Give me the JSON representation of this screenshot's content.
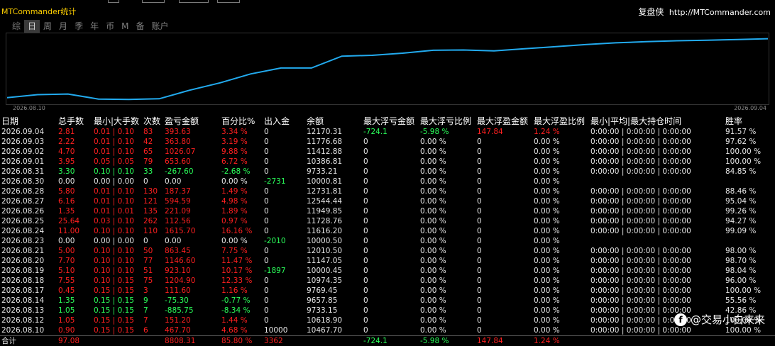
{
  "header": {
    "title": "MTCommander统计",
    "brand": "复盘侠",
    "url": "http://MTCommander.com"
  },
  "tabs": [
    {
      "label": "综",
      "active": false
    },
    {
      "label": "日",
      "active": true
    },
    {
      "label": "周",
      "active": false
    },
    {
      "label": "月",
      "active": false
    },
    {
      "label": "季",
      "active": false
    },
    {
      "label": "年",
      "active": false
    },
    {
      "label": "币",
      "active": false
    },
    {
      "label": "M",
      "active": false
    },
    {
      "label": "备",
      "active": false
    },
    {
      "label": "账户",
      "active": false
    }
  ],
  "chart_data": {
    "type": "line",
    "x_start_label": "2026.08.10",
    "x_end_label": "2026.09.04",
    "line_color": "#22aaee",
    "x": [
      "2026.08.10",
      "2026.08.12",
      "2026.08.13",
      "2026.08.14",
      "2026.08.17",
      "2026.08.18",
      "2026.08.19",
      "2026.08.20",
      "2026.08.21",
      "2026.08.23",
      "2026.08.24",
      "2026.08.25",
      "2026.08.26",
      "2026.08.27",
      "2026.08.28",
      "2026.08.30",
      "2026.08.31",
      "2026.09.01",
      "2026.09.02",
      "2026.09.03",
      "2026.09.04"
    ],
    "values": [
      10467.7,
      10618.9,
      9733.15,
      9657.85,
      9769.45,
      10974.35,
      10000.45,
      11147.05,
      12010.5,
      10000.5,
      11616.2,
      11728.76,
      11949.85,
      12544.44,
      12731.81,
      10000.81,
      9733.21,
      10386.81,
      11412.88,
      11776.68,
      12170.31
    ],
    "chart_values": [
      200,
      210,
      212,
      195,
      194,
      196,
      225,
      250,
      280,
      300,
      300,
      340,
      343,
      350,
      360,
      361,
      358,
      365,
      372,
      379,
      385,
      389,
      392,
      394,
      396,
      399
    ],
    "ylim": [
      180,
      410
    ]
  },
  "table": {
    "headers": [
      "日期",
      "总手数",
      "最小|大手数",
      "次数",
      "盈亏金额",
      "百分比%",
      "出入金",
      "余额",
      "最大浮亏金额",
      "最大浮亏比例",
      "最大浮盈金额",
      "最大浮盈比例",
      "最小|平均|最大持仓时间",
      "胜率"
    ],
    "rows": [
      [
        "2026.09.04",
        "2.81",
        "0.01 | 0.10",
        "83",
        "393.63",
        "3.34 %",
        "0",
        "12170.31",
        "-724.1",
        "-5.98 %",
        "147.84",
        "1.24 %",
        "0:00:00 | 0:00:00 | 0:00:00",
        "91.57 %"
      ],
      [
        "2026.09.03",
        "2.22",
        "0.01 | 0.10",
        "42",
        "363.80",
        "3.19 %",
        "0",
        "11776.68",
        "0",
        "0.00 %",
        "0",
        "0.00 %",
        "0:00:00 | 0:00:00 | 0:00:00",
        "97.62 %"
      ],
      [
        "2026.09.02",
        "4.70",
        "0.01 | 0.10",
        "65",
        "1026.07",
        "9.88 %",
        "0",
        "11412.88",
        "0",
        "0.00 %",
        "0",
        "0.00 %",
        "0:00:00 | 0:00:00 | 0:00:00",
        "100.00 %"
      ],
      [
        "2026.09.01",
        "3.95",
        "0.05 | 0.05",
        "79",
        "653.60",
        "6.72 %",
        "0",
        "10386.81",
        "0",
        "0.00 %",
        "0",
        "0.00 %",
        "0:00:00 | 0:00:00 | 0:00:00",
        "100.00 %"
      ],
      [
        "2026.08.31",
        "3.30",
        "0.10 | 0.10",
        "33",
        "-267.60",
        "-2.68 %",
        "0",
        "9733.21",
        "0",
        "0.00 %",
        "0",
        "0.00 %",
        "0:00:00 | 0:00:00 | 0:00:00",
        "84.85 %"
      ],
      [
        "2026.08.30",
        "0.00",
        "0.00 | 0.00",
        "0",
        "0.00",
        "0.00 %",
        "-2731",
        "10000.81",
        "0",
        "0.00 %",
        "0",
        "0.00 %",
        "",
        ""
      ],
      [
        "2026.08.28",
        "5.80",
        "0.01 | 0.10",
        "130",
        "187.37",
        "1.49 %",
        "0",
        "12731.81",
        "0",
        "0.00 %",
        "0",
        "0.00 %",
        "0:00:00 | 0:00:00 | 0:00:00",
        "88.46 %"
      ],
      [
        "2026.08.27",
        "6.16",
        "0.01 | 0.10",
        "121",
        "594.59",
        "4.98 %",
        "0",
        "12544.44",
        "0",
        "0.00 %",
        "0",
        "0.00 %",
        "0:00:00 | 0:00:00 | 0:00:00",
        "95.04 %"
      ],
      [
        "2026.08.26",
        "1.35",
        "0.01 | 0.01",
        "135",
        "221.09",
        "1.89 %",
        "0",
        "11949.85",
        "0",
        "0.00 %",
        "0",
        "0.00 %",
        "0:00:00 | 0:00:00 | 0:00:00",
        "99.26 %"
      ],
      [
        "2026.08.25",
        "25.64",
        "0.03 | 0.10",
        "262",
        "112.56",
        "0.97 %",
        "0",
        "11728.76",
        "0",
        "0.00 %",
        "0",
        "0.00 %",
        "0:00:00 | 0:00:00 | 0:00:00",
        "94.27 %"
      ],
      [
        "2026.08.24",
        "11.00",
        "0.10 | 0.10",
        "110",
        "1615.70",
        "16.16 %",
        "0",
        "11616.20",
        "0",
        "0.00 %",
        "0",
        "0.00 %",
        "0:00:00 | 0:00:00 | 0:00:00",
        "99.09 %"
      ],
      [
        "2026.08.23",
        "0.00",
        "0.00 | 0.00",
        "0",
        "0.00",
        "0.00 %",
        "-2010",
        "10000.50",
        "0",
        "0.00 %",
        "0",
        "0.00 %",
        "",
        ""
      ],
      [
        "2026.08.21",
        "5.00",
        "0.10 | 0.10",
        "50",
        "863.45",
        "7.75 %",
        "0",
        "12010.50",
        "0",
        "0.00 %",
        "0",
        "0.00 %",
        "0:00:00 | 0:00:00 | 0:00:00",
        "98.00 %"
      ],
      [
        "2026.08.20",
        "7.70",
        "0.10 | 0.10",
        "77",
        "1146.60",
        "11.47 %",
        "0",
        "11147.05",
        "0",
        "0.00 %",
        "0",
        "0.00 %",
        "0:00:00 | 0:00:00 | 0:00:00",
        "98.70 %"
      ],
      [
        "2026.08.19",
        "5.10",
        "0.10 | 0.10",
        "51",
        "923.10",
        "10.17 %",
        "-1897",
        "10000.45",
        "0",
        "0.00 %",
        "0",
        "0.00 %",
        "0:00:00 | 0:00:00 | 0:00:00",
        "98.04 %"
      ],
      [
        "2026.08.18",
        "7.55",
        "0.10 | 0.15",
        "75",
        "1204.90",
        "12.33 %",
        "0",
        "10974.35",
        "0",
        "0.00 %",
        "0",
        "0.00 %",
        "0:00:00 | 0:00:00 | 0:00:00",
        "96.00 %"
      ],
      [
        "2026.08.17",
        "0.45",
        "0.15 | 0.15",
        "3",
        "111.60",
        "1.16 %",
        "0",
        "9769.45",
        "0",
        "0.00 %",
        "0",
        "0.00 %",
        "0:00:00 | 0:00:00 | 0:00:00",
        "100.00 %"
      ],
      [
        "2026.08.14",
        "1.35",
        "0.15 | 0.15",
        "9",
        "-75.30",
        "-0.77 %",
        "0",
        "9657.85",
        "0",
        "0.00 %",
        "0",
        "0.00 %",
        "0:00:00 | 0:00:00 | 0:00:00",
        "55.56 %"
      ],
      [
        "2026.08.13",
        "1.05",
        "0.15 | 0.15",
        "7",
        "-885.75",
        "-8.34 %",
        "0",
        "9733.15",
        "0",
        "0.00 %",
        "0",
        "0.00 %",
        "0:00:00 | 0:00:00 | 0:00:00",
        "42.86 %"
      ],
      [
        "2026.08.12",
        "1.05",
        "0.15 | 0.15",
        "7",
        "151.20",
        "1.44 %",
        "0",
        "10618.90",
        "0",
        "0.00 %",
        "0",
        "0.00 %",
        "0:00:00 | 0:00:00 | 0:00:00",
        "100.00 %"
      ],
      [
        "2026.08.10",
        "0.90",
        "0.15 | 0.15",
        "6",
        "467.70",
        "4.68 %",
        "10000",
        "10467.70",
        "0",
        "0.00 %",
        "0",
        "0.00 %",
        "0:00:00 | 0:00:00 | 0:00:00",
        "100.00 %"
      ]
    ],
    "row_colors": [
      "r",
      "r",
      "r",
      "r",
      "g",
      "w",
      "r",
      "r",
      "r",
      "r",
      "r",
      "w",
      "r",
      "r",
      "r",
      "r",
      "r",
      "g",
      "g",
      "r",
      "r"
    ],
    "summary": [
      "合计",
      "97.08",
      "",
      "",
      "8808.31",
      "85.80 %",
      "3362",
      "",
      "-724.1",
      "-5.98 %",
      "147.84",
      "1.24 %",
      "",
      ""
    ]
  },
  "watermark": {
    "icon": "facebook-icon",
    "text": "@交易小白来来"
  }
}
